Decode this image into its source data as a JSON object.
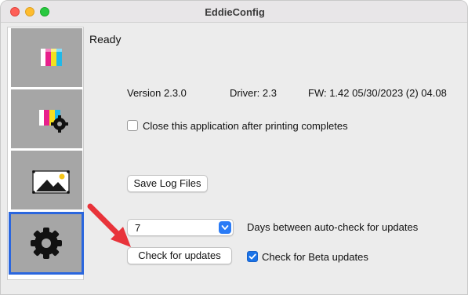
{
  "window": {
    "title": "EddieConfig"
  },
  "sidebar": {
    "items": [
      {
        "icon": "ink-cartridges-icon"
      },
      {
        "icon": "ink-settings-icon"
      },
      {
        "icon": "image-icon"
      },
      {
        "icon": "gear-icon",
        "selected": true
      }
    ]
  },
  "main": {
    "status": "Ready",
    "version": "Version 2.3.0",
    "driver": "Driver: 2.3",
    "firmware": "FW: 1.42  05/30/2023 (2) 04.08",
    "close_after_printing": {
      "label": "Close this application after printing completes",
      "checked": false
    },
    "save_log_label": "Save Log Files",
    "auto_check": {
      "value": "7",
      "label": "Days between auto-check for updates"
    },
    "check_updates_label": "Check for updates",
    "beta_updates": {
      "label": "Check for Beta updates",
      "checked": true
    }
  },
  "colors": {
    "accent": "#2a66de",
    "arrow": "#e8333a",
    "sidebar_tile": "#a6a6a6"
  }
}
